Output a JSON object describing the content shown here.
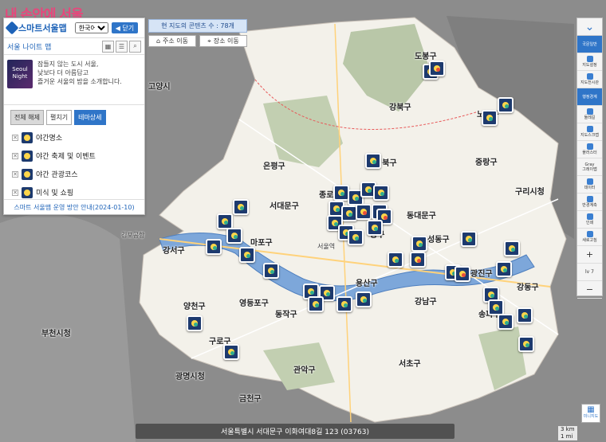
{
  "brand": "내 손안에 서울",
  "panel": {
    "logo": "스마트서울맵",
    "language_selected": "한국어",
    "close_label": "닫기",
    "title": "서울 나이트 맵",
    "thumb_text": "Seoul Night",
    "description": [
      "잠들지 않는 도시 서울,",
      "낮보다 더 아름답고",
      "즐거운 서울의 밤을 소개합니다."
    ],
    "tabs": [
      "전체 해제",
      "펼치기",
      "테마상세"
    ],
    "layers": [
      "야간명소",
      "야간 축제 및 이벤트",
      "야간 관광코스",
      "미식 및 쇼핑"
    ],
    "notice": "스마트 서울맵 운영 방안 안내(2024-01-10)"
  },
  "content_count": "현 지도의 콘텐츠 수 : 78개",
  "address_move": "주소 이동",
  "place_move": "장소 이동",
  "address_bar": "서울특별시 서대문구 이화여대8길 123 (03763)",
  "scale": [
    "3 km",
    "1 mi"
  ],
  "minimap_label": "미니지도",
  "toolbar": [
    "국문일반",
    "지도설정",
    "지도전시관",
    "행정경계",
    "둘레길",
    "지도스크랩",
    "플러스터",
    "Gray",
    "그레이맵",
    "데이터",
    "반경계측",
    "인쇄",
    "새로고침",
    "+",
    "lv 7",
    "−"
  ],
  "places": [
    {
      "name": "도봉구"
    },
    {
      "name": "강북구"
    },
    {
      "name": "노원구"
    },
    {
      "name": "중랑구"
    },
    {
      "name": "은평구"
    },
    {
      "name": "서대문구"
    },
    {
      "name": "성북구"
    },
    {
      "name": "동대문구"
    },
    {
      "name": "종로구"
    },
    {
      "name": "중구"
    },
    {
      "name": "성동구"
    },
    {
      "name": "광진구"
    },
    {
      "name": "마포구"
    },
    {
      "name": "용산구"
    },
    {
      "name": "강서구"
    },
    {
      "name": "양천구"
    },
    {
      "name": "영등포구"
    },
    {
      "name": "동작구"
    },
    {
      "name": "강남구"
    },
    {
      "name": "송파구"
    },
    {
      "name": "강동구"
    },
    {
      "name": "구로구"
    },
    {
      "name": "금천구"
    },
    {
      "name": "관악구"
    },
    {
      "name": "서초구"
    },
    {
      "name": "고양시"
    },
    {
      "name": "부천시청"
    },
    {
      "name": "광명시청"
    },
    {
      "name": "구리시청"
    },
    {
      "name": "김포공항"
    },
    {
      "name": "서울역"
    }
  ]
}
